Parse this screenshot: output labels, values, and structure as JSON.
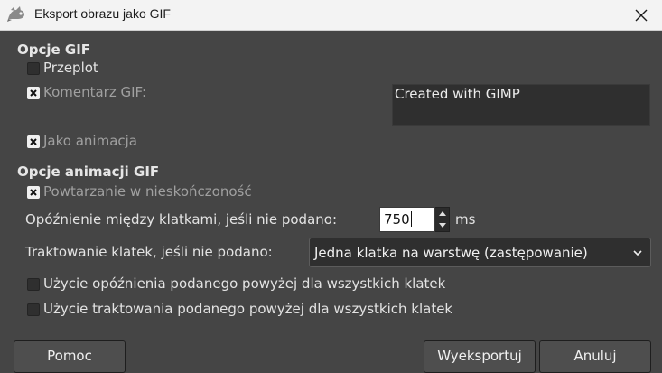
{
  "window": {
    "title": "Eksport obrazu jako GIF",
    "app_icon": "gimp-wilber-icon",
    "close_icon": "close-icon"
  },
  "gif_options": {
    "title": "Opcje GIF",
    "interlace": {
      "label": "Przeplot",
      "checked": false
    },
    "comment": {
      "label": "Komentarz GIF:",
      "checked": true,
      "value": "Created with GIMP"
    },
    "as_animation": {
      "label": "Jako animacja",
      "checked": true
    }
  },
  "animation_options": {
    "title": "Opcje animacji GIF",
    "loop_forever": {
      "label": "Powtarzanie w nieskończoność",
      "checked": true
    },
    "delay": {
      "label": "Opóźnienie między klatkami, jeśli nie podano:",
      "value": "750",
      "unit": "ms"
    },
    "frame_disposal": {
      "label": "Traktowanie klatek, jeśli nie podano:",
      "selected": "Jedna klatka na warstwę (zastępowanie)"
    },
    "use_delay_all": {
      "label": "Użycie opóźnienia podanego powyżej dla wszystkich klatek",
      "checked": false
    },
    "use_disposal_all": {
      "label": "Użycie traktowania podanego powyżej dla wszystkich klatek",
      "checked": false
    }
  },
  "buttons": {
    "help": "Pomoc",
    "export": "Wyeksportuj",
    "cancel": "Anuluj"
  },
  "colors": {
    "background": "#454545",
    "titlebar": "#f3f3f3"
  }
}
